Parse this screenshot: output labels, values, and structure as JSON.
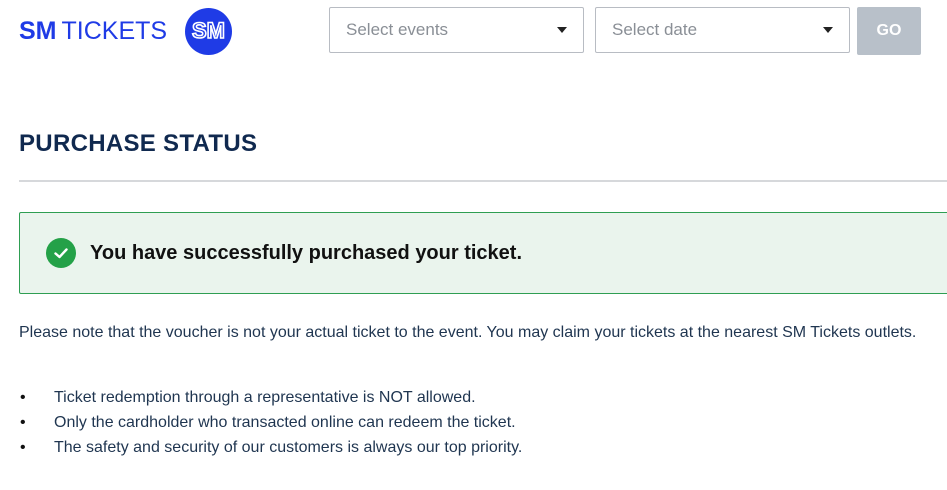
{
  "header": {
    "logo": {
      "brand_bold": "SM",
      "brand_light": "TICKETS",
      "badge_text": "SM"
    },
    "events_select": {
      "placeholder": "Select events"
    },
    "date_select": {
      "placeholder": "Select date"
    },
    "go_button": {
      "label": "GO"
    }
  },
  "main": {
    "title": "PURCHASE STATUS",
    "alert": {
      "message": "You have successfully purchased your ticket.",
      "icon": "check-circle-icon",
      "status": "success"
    },
    "note": "Please note that the voucher is not your actual ticket to the event. You may claim your tickets at the nearest SM Tickets outlets.",
    "rules": [
      "Ticket redemption through a representative is NOT allowed.",
      "Only the cardholder who transacted online can redeem the ticket.",
      "The safety and security of our customers is always our top priority."
    ]
  },
  "colors": {
    "brand_blue": "#1f3be6",
    "title_navy": "#10294f",
    "success_green": "#24a148",
    "alert_background": "#eaf4ed",
    "go_button_disabled": "#b8c0c9"
  }
}
